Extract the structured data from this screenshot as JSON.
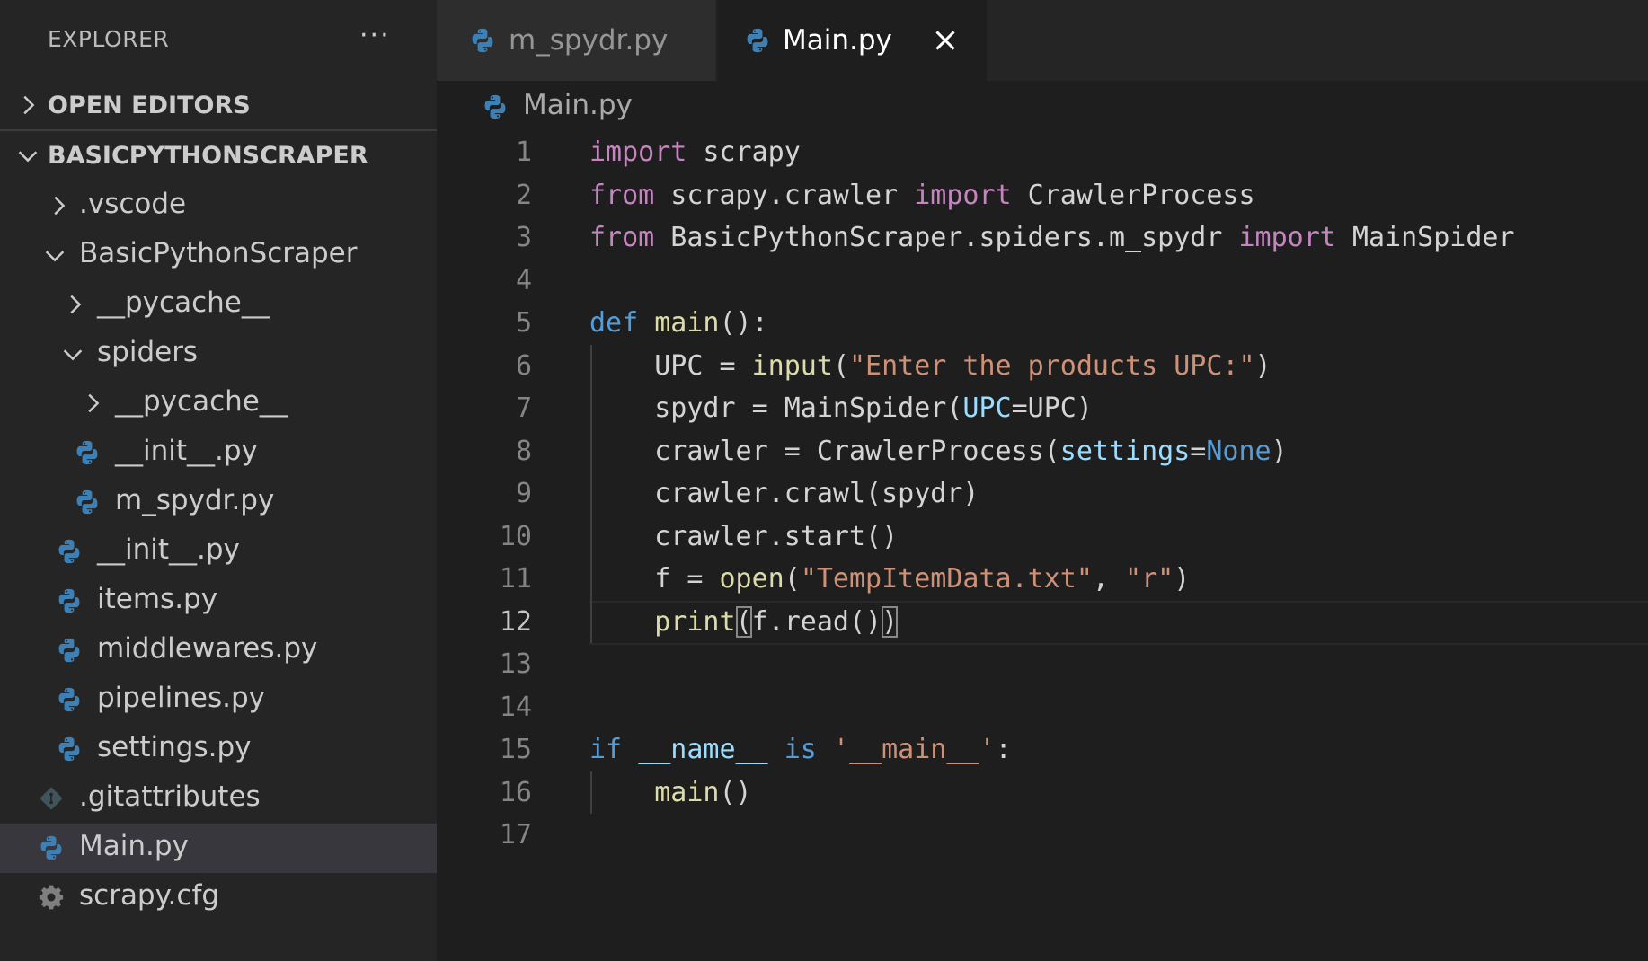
{
  "sidebar": {
    "title": "EXPLORER",
    "more_label": "···",
    "open_editors_label": "OPEN EDITORS",
    "project_label": "BASICPYTHONSCRAPER",
    "tree": [
      {
        "label": ".vscode",
        "type": "folder",
        "expanded": false
      },
      {
        "label": "BasicPythonScraper",
        "type": "folder",
        "expanded": true
      },
      {
        "label": "__pycache__",
        "type": "folder",
        "expanded": false
      },
      {
        "label": "spiders",
        "type": "folder",
        "expanded": true
      },
      {
        "label": "__pycache__",
        "type": "folder",
        "expanded": false
      },
      {
        "label": "__init__.py",
        "type": "python-file"
      },
      {
        "label": "m_spydr.py",
        "type": "python-file"
      },
      {
        "label": "__init__.py",
        "type": "python-file"
      },
      {
        "label": "items.py",
        "type": "python-file"
      },
      {
        "label": "middlewares.py",
        "type": "python-file"
      },
      {
        "label": "pipelines.py",
        "type": "python-file"
      },
      {
        "label": "settings.py",
        "type": "python-file"
      },
      {
        "label": ".gitattributes",
        "type": "git-file"
      },
      {
        "label": "Main.py",
        "type": "python-file",
        "selected": true
      },
      {
        "label": "scrapy.cfg",
        "type": "config-file"
      }
    ]
  },
  "tabs": [
    {
      "label": "m_spydr.py",
      "active": false
    },
    {
      "label": "Main.py",
      "active": true
    }
  ],
  "breadcrumb": {
    "label": "Main.py"
  },
  "editor": {
    "current_line": 12,
    "line_numbers": [
      "1",
      "2",
      "3",
      "4",
      "5",
      "6",
      "7",
      "8",
      "9",
      "10",
      "11",
      "12",
      "13",
      "14",
      "15",
      "16",
      "17"
    ],
    "lines": [
      "import scrapy",
      "from scrapy.crawler import CrawlerProcess",
      "from BasicPythonScraper.spiders.m_spydr import MainSpider",
      "",
      "def main():",
      "    UPC = input(\"Enter the products UPC:\")",
      "    spydr = MainSpider(UPC=UPC)",
      "    crawler = CrawlerProcess(settings=None)",
      "    crawler.crawl(spydr)",
      "    crawler.start()",
      "    f = open(\"TempItemData.txt\", \"r\")",
      "    print(f.read())",
      "",
      "",
      "if __name__ is '__main__':",
      "    main()",
      ""
    ]
  },
  "colors": {
    "keyword": "#c586c0",
    "keyword_blue": "#569cd6",
    "function": "#dcdcaa",
    "string": "#ce9178",
    "parameter": "#9cdcfe",
    "text": "#d4d4d4",
    "python_icon": "#3e7fb4"
  }
}
